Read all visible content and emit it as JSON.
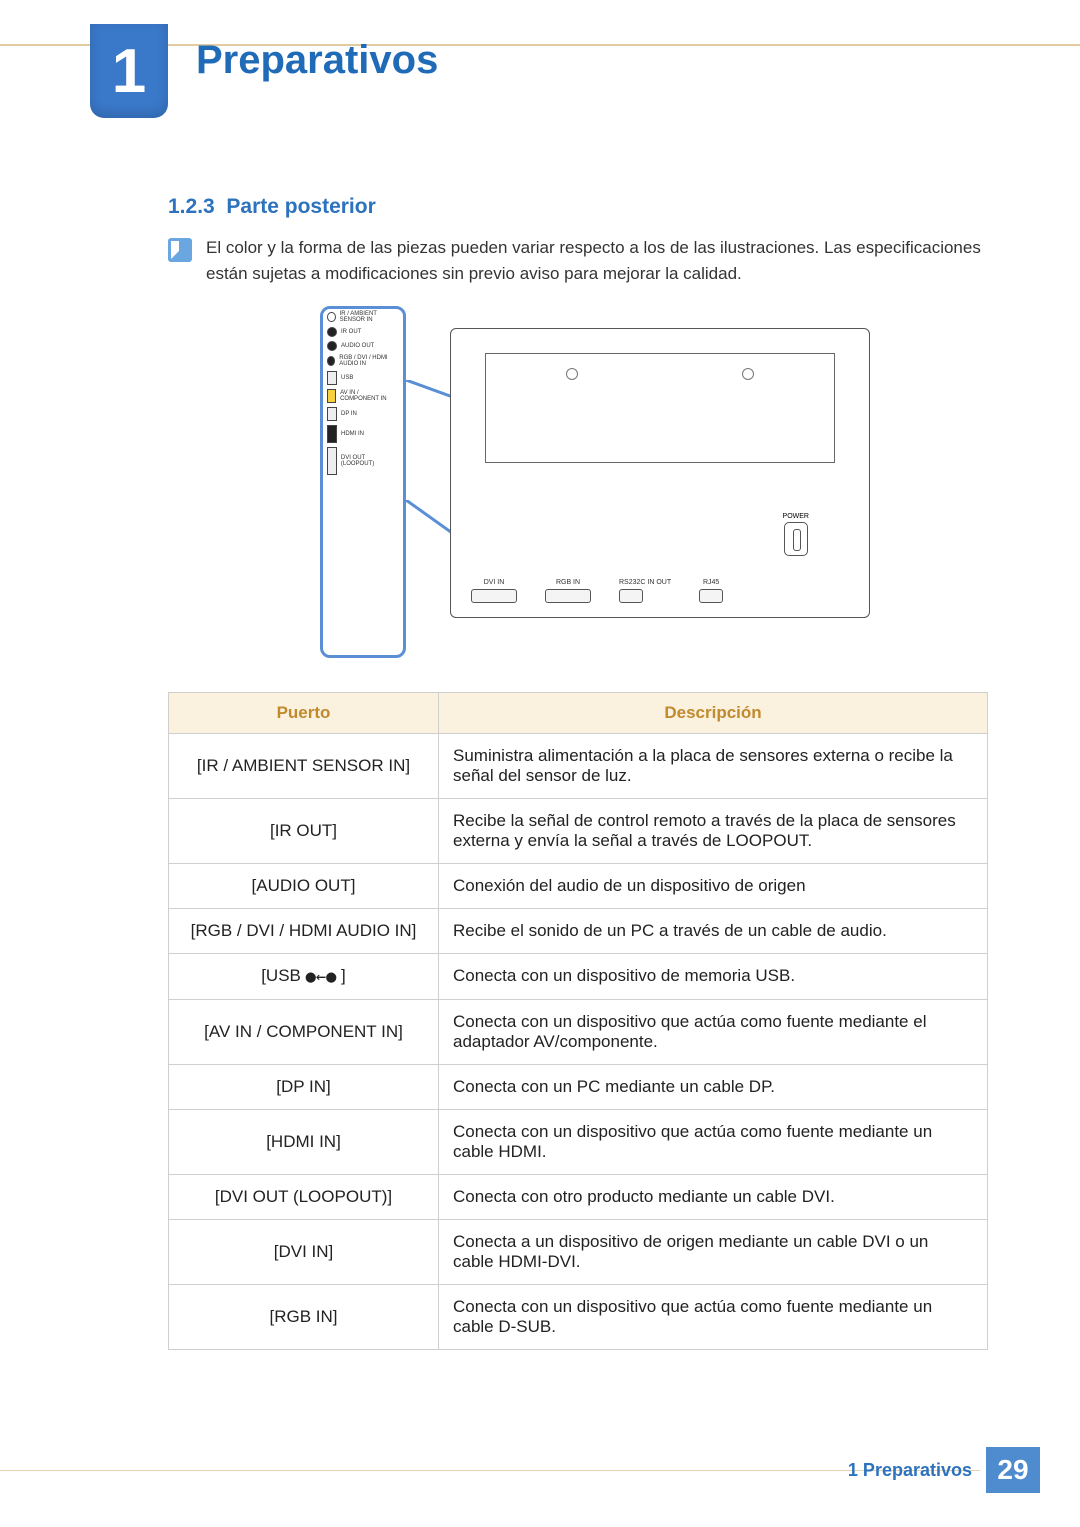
{
  "chapter": {
    "number": "1",
    "title": "Preparativos"
  },
  "section": {
    "number": "1.2.3",
    "title": "Parte posterior"
  },
  "note": "El color y la forma de las piezas pueden variar respecto a los de las ilustraciones. Las especificaciones están sujetas a modificaciones sin previo aviso para mejorar la calidad.",
  "diagram": {
    "side_ports": [
      "IR / AMBIENT SENSOR IN",
      "IR OUT",
      "AUDIO OUT",
      "RGB / DVI / HDMI AUDIO IN",
      "USB",
      "AV IN / COMPONENT IN",
      "DP IN",
      "HDMI IN",
      "DVI OUT (LOOPOUT)"
    ],
    "bottom_ports": [
      "DVI IN",
      "RGB IN",
      "RS232C IN  OUT",
      "RJ45"
    ],
    "power_label": "POWER"
  },
  "table": {
    "headers": {
      "port": "Puerto",
      "desc": "Descripción"
    },
    "rows": [
      {
        "port": "[IR / AMBIENT SENSOR IN]",
        "desc": "Suministra alimentación a la placa de sensores externa o recibe la señal del sensor de luz."
      },
      {
        "port": "[IR OUT]",
        "desc": "Recibe la señal de control remoto a través de la placa de sensores externa y envía la señal a través de LOOPOUT."
      },
      {
        "port": "[AUDIO OUT]",
        "desc": "Conexión del audio de un dispositivo de origen"
      },
      {
        "port": "[RGB / DVI / HDMI AUDIO IN]",
        "desc": "Recibe el sonido de un PC a través de un cable de audio."
      },
      {
        "port": "[USB ⬈⬉ ]",
        "desc": "Conecta con un dispositivo de memoria USB."
      },
      {
        "port": "[AV IN / COMPONENT IN]",
        "desc": "Conecta con un dispositivo que actúa como fuente mediante el adaptador AV/componente."
      },
      {
        "port": "[DP IN]",
        "desc": "Conecta con un PC mediante un cable DP."
      },
      {
        "port": "[HDMI IN]",
        "desc": "Conecta con un dispositivo que actúa como fuente mediante un cable HDMI."
      },
      {
        "port": "[DVI OUT (LOOPOUT)]",
        "desc": "Conecta con otro producto mediante un cable DVI."
      },
      {
        "port": "[DVI IN]",
        "desc": "Conecta a un dispositivo de origen mediante un cable DVI o un cable HDMI-DVI."
      },
      {
        "port": "[RGB IN]",
        "desc": "Conecta con un dispositivo que actúa como fuente mediante un cable D-SUB."
      }
    ]
  },
  "footer": {
    "label": "1 Preparativos",
    "page": "29"
  }
}
